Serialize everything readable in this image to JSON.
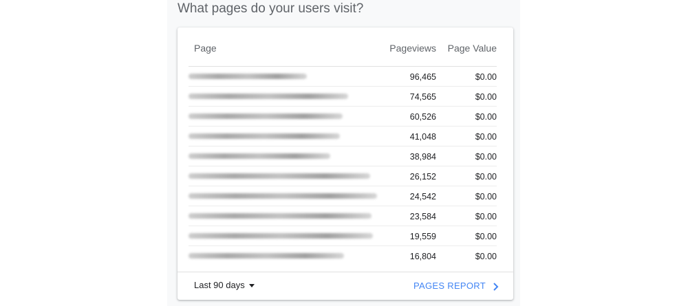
{
  "heading": "What pages do your users visit?",
  "table": {
    "columns": {
      "page": "Page",
      "pageviews": "Pageviews",
      "value": "Page Value"
    },
    "rows": [
      {
        "pageviews": "96,465",
        "value": "$0.00"
      },
      {
        "pageviews": "74,565",
        "value": "$0.00"
      },
      {
        "pageviews": "60,526",
        "value": "$0.00"
      },
      {
        "pageviews": "41,048",
        "value": "$0.00"
      },
      {
        "pageviews": "38,984",
        "value": "$0.00"
      },
      {
        "pageviews": "26,152",
        "value": "$0.00"
      },
      {
        "pageviews": "24,542",
        "value": "$0.00"
      },
      {
        "pageviews": "23,584",
        "value": "$0.00"
      },
      {
        "pageviews": "19,559",
        "value": "$0.00"
      },
      {
        "pageviews": "16,804",
        "value": "$0.00"
      }
    ]
  },
  "footer": {
    "date_range": "Last 90 days",
    "report_link": "PAGES REPORT"
  },
  "icons": {
    "date_range_caret": "caret-down-icon",
    "report_arrow": "chevron-right-icon"
  },
  "colors": {
    "accent": "#4285f4",
    "heading": "#5f6368",
    "panel_background": "#f8f9fa"
  }
}
